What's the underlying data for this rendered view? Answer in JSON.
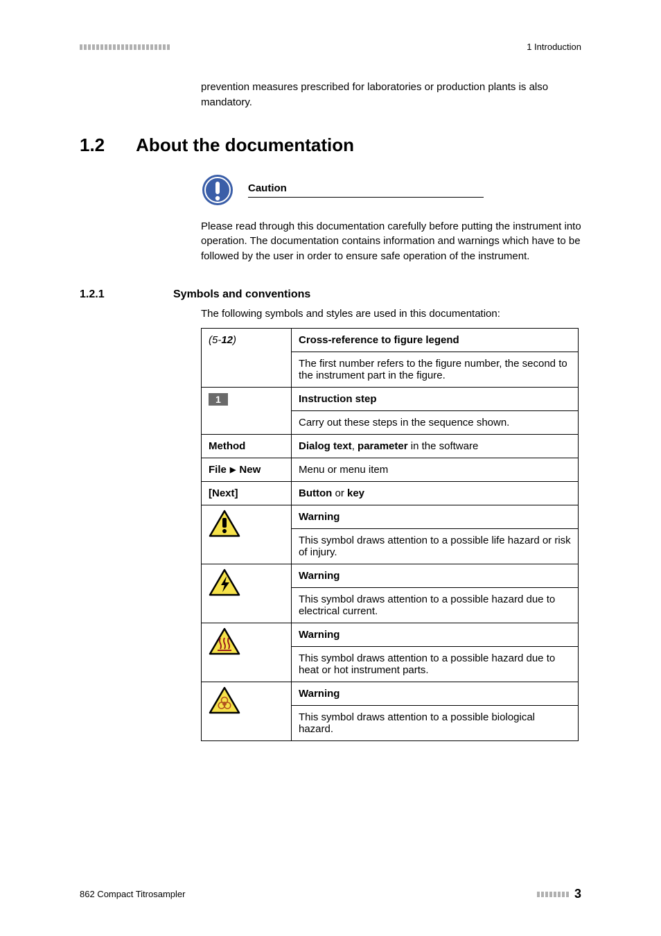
{
  "header": {
    "chapter": "1 Introduction"
  },
  "continued_text": "prevention measures prescribed for laboratories or production plants is also mandatory.",
  "section": {
    "number": "1.2",
    "title": "About the documentation"
  },
  "caution": {
    "label": "Caution",
    "text": "Please read through this documentation carefully before putting the instrument into operation. The documentation contains information and warnings which have to be followed by the user in order to ensure safe operation of the instrument."
  },
  "subsection": {
    "number": "1.2.1",
    "title": "Symbols and conventions",
    "intro": "The following symbols and styles are used in this documentation:"
  },
  "table": {
    "row_crossref": {
      "left_prefix": "(5-",
      "left_bold": "12",
      "left_suffix": ")",
      "title": "Cross-reference to figure legend",
      "desc": "The first number refers to the figure number, the second to the instrument part in the figure."
    },
    "row_step": {
      "badge": "1",
      "title": "Instruction step",
      "desc": "Carry out these steps in the sequence shown."
    },
    "row_method": {
      "left": "Method",
      "bold1": "Dialog text",
      "mid1": ", ",
      "bold2": "parameter",
      "mid2": " in the software"
    },
    "row_file": {
      "left1": "File",
      "left2": "New",
      "desc": "Menu or menu item"
    },
    "row_next": {
      "left": "[Next]",
      "bold1": "Button",
      "mid": " or ",
      "bold2": "key"
    },
    "row_warn_life": {
      "title": "Warning",
      "desc": "This symbol draws attention to a possible life hazard or risk of injury."
    },
    "row_warn_elec": {
      "title": "Warning",
      "desc": "This symbol draws attention to a possible hazard due to electrical current."
    },
    "row_warn_heat": {
      "title": "Warning",
      "desc": "This symbol draws attention to a possible hazard due to heat or hot instrument parts."
    },
    "row_warn_bio": {
      "title": "Warning",
      "desc": "This symbol draws attention to a possible biological hazard."
    }
  },
  "footer": {
    "left": "862 Compact Titrosampler",
    "page": "3"
  }
}
